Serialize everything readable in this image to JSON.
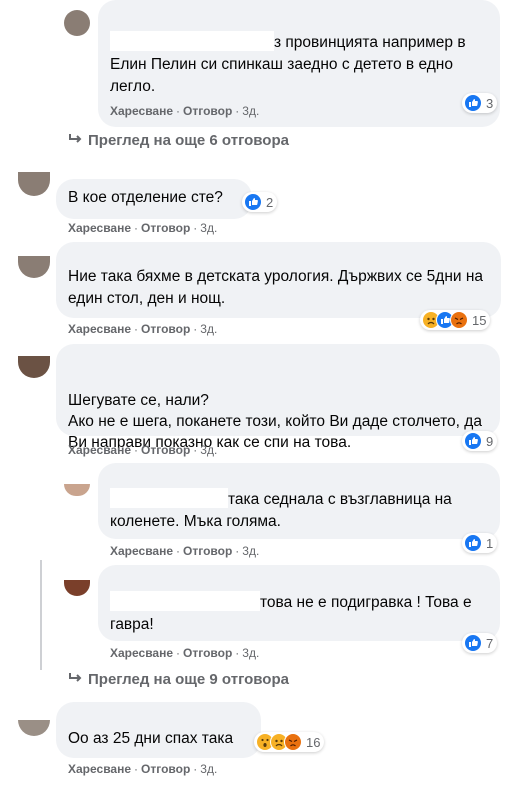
{
  "actions": {
    "like": "Харесване",
    "reply": "Отговор",
    "time": "3д."
  },
  "comments": [
    {
      "id": "c1",
      "text": "з провинцията например в Елин Пелин си спинкаш заедно с детето в едно легло.",
      "reactions": "3"
    },
    {
      "id": "c2",
      "text": "В кое отделение сте?",
      "reactions": "2"
    },
    {
      "id": "c3",
      "text": "Ние така бяхме в детската урология. Държвих се 5дни на един стол, ден и нощ.",
      "reactions": "15"
    },
    {
      "id": "c4",
      "text": "Шегувате се, нали?\nАко не е шега, поканете този, който Ви даде столчето, да Ви направи показно как се спи на това.",
      "reactions": "9"
    },
    {
      "id": "c5",
      "text": "така седнала с възглавница на коленете. Мъка голяма.",
      "reactions": "1"
    },
    {
      "id": "c6",
      "text": "това не е подигравка ! Това е гавра!",
      "reactions": "7"
    },
    {
      "id": "c7",
      "text": "Оо аз 25 дни спах така",
      "reactions": "16"
    }
  ],
  "more_replies": [
    {
      "label": "Преглед на още 6 отговора"
    },
    {
      "label": "Преглед на още 9 отговора"
    }
  ],
  "colors": {
    "bubble": "#f0f2f5",
    "secondary_text": "#65676b",
    "like_blue": "#1877f2"
  },
  "icons": {
    "like": "thumbs-up-icon",
    "sad": "sad-face-icon",
    "wow": "wow-face-icon",
    "angry": "angry-face-icon",
    "reply_arrow": "reply-arrow-icon"
  }
}
